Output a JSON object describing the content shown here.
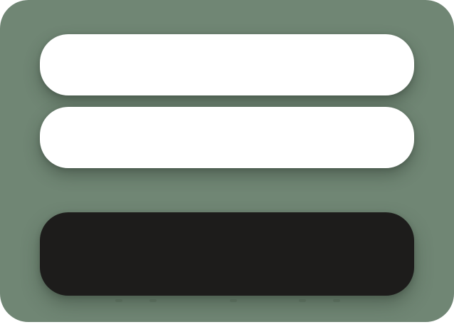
{
  "screen": {
    "background_color": "#708674",
    "field_color": "#ffffff",
    "button_color": "#1d1c1b"
  },
  "form": {
    "fields": [
      {
        "value": "",
        "placeholder": ""
      },
      {
        "value": "",
        "placeholder": ""
      }
    ],
    "primary_button": {
      "label": ""
    }
  }
}
